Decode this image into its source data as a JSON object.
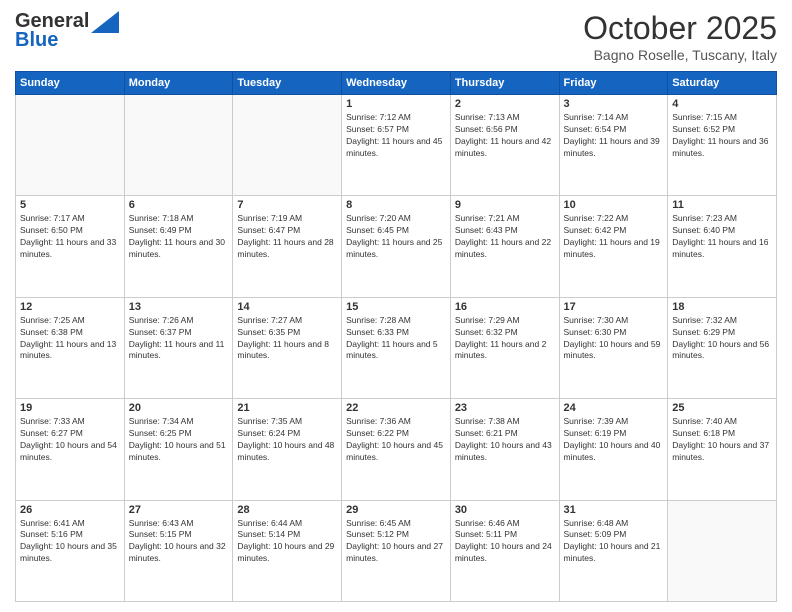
{
  "header": {
    "logo_line1": "General",
    "logo_line2": "Blue",
    "month": "October 2025",
    "location": "Bagno Roselle, Tuscany, Italy"
  },
  "days_of_week": [
    "Sunday",
    "Monday",
    "Tuesday",
    "Wednesday",
    "Thursday",
    "Friday",
    "Saturday"
  ],
  "weeks": [
    [
      {
        "day": "",
        "text": ""
      },
      {
        "day": "",
        "text": ""
      },
      {
        "day": "",
        "text": ""
      },
      {
        "day": "1",
        "text": "Sunrise: 7:12 AM\nSunset: 6:57 PM\nDaylight: 11 hours and 45 minutes."
      },
      {
        "day": "2",
        "text": "Sunrise: 7:13 AM\nSunset: 6:56 PM\nDaylight: 11 hours and 42 minutes."
      },
      {
        "day": "3",
        "text": "Sunrise: 7:14 AM\nSunset: 6:54 PM\nDaylight: 11 hours and 39 minutes."
      },
      {
        "day": "4",
        "text": "Sunrise: 7:15 AM\nSunset: 6:52 PM\nDaylight: 11 hours and 36 minutes."
      }
    ],
    [
      {
        "day": "5",
        "text": "Sunrise: 7:17 AM\nSunset: 6:50 PM\nDaylight: 11 hours and 33 minutes."
      },
      {
        "day": "6",
        "text": "Sunrise: 7:18 AM\nSunset: 6:49 PM\nDaylight: 11 hours and 30 minutes."
      },
      {
        "day": "7",
        "text": "Sunrise: 7:19 AM\nSunset: 6:47 PM\nDaylight: 11 hours and 28 minutes."
      },
      {
        "day": "8",
        "text": "Sunrise: 7:20 AM\nSunset: 6:45 PM\nDaylight: 11 hours and 25 minutes."
      },
      {
        "day": "9",
        "text": "Sunrise: 7:21 AM\nSunset: 6:43 PM\nDaylight: 11 hours and 22 minutes."
      },
      {
        "day": "10",
        "text": "Sunrise: 7:22 AM\nSunset: 6:42 PM\nDaylight: 11 hours and 19 minutes."
      },
      {
        "day": "11",
        "text": "Sunrise: 7:23 AM\nSunset: 6:40 PM\nDaylight: 11 hours and 16 minutes."
      }
    ],
    [
      {
        "day": "12",
        "text": "Sunrise: 7:25 AM\nSunset: 6:38 PM\nDaylight: 11 hours and 13 minutes."
      },
      {
        "day": "13",
        "text": "Sunrise: 7:26 AM\nSunset: 6:37 PM\nDaylight: 11 hours and 11 minutes."
      },
      {
        "day": "14",
        "text": "Sunrise: 7:27 AM\nSunset: 6:35 PM\nDaylight: 11 hours and 8 minutes."
      },
      {
        "day": "15",
        "text": "Sunrise: 7:28 AM\nSunset: 6:33 PM\nDaylight: 11 hours and 5 minutes."
      },
      {
        "day": "16",
        "text": "Sunrise: 7:29 AM\nSunset: 6:32 PM\nDaylight: 11 hours and 2 minutes."
      },
      {
        "day": "17",
        "text": "Sunrise: 7:30 AM\nSunset: 6:30 PM\nDaylight: 10 hours and 59 minutes."
      },
      {
        "day": "18",
        "text": "Sunrise: 7:32 AM\nSunset: 6:29 PM\nDaylight: 10 hours and 56 minutes."
      }
    ],
    [
      {
        "day": "19",
        "text": "Sunrise: 7:33 AM\nSunset: 6:27 PM\nDaylight: 10 hours and 54 minutes."
      },
      {
        "day": "20",
        "text": "Sunrise: 7:34 AM\nSunset: 6:25 PM\nDaylight: 10 hours and 51 minutes."
      },
      {
        "day": "21",
        "text": "Sunrise: 7:35 AM\nSunset: 6:24 PM\nDaylight: 10 hours and 48 minutes."
      },
      {
        "day": "22",
        "text": "Sunrise: 7:36 AM\nSunset: 6:22 PM\nDaylight: 10 hours and 45 minutes."
      },
      {
        "day": "23",
        "text": "Sunrise: 7:38 AM\nSunset: 6:21 PM\nDaylight: 10 hours and 43 minutes."
      },
      {
        "day": "24",
        "text": "Sunrise: 7:39 AM\nSunset: 6:19 PM\nDaylight: 10 hours and 40 minutes."
      },
      {
        "day": "25",
        "text": "Sunrise: 7:40 AM\nSunset: 6:18 PM\nDaylight: 10 hours and 37 minutes."
      }
    ],
    [
      {
        "day": "26",
        "text": "Sunrise: 6:41 AM\nSunset: 5:16 PM\nDaylight: 10 hours and 35 minutes."
      },
      {
        "day": "27",
        "text": "Sunrise: 6:43 AM\nSunset: 5:15 PM\nDaylight: 10 hours and 32 minutes."
      },
      {
        "day": "28",
        "text": "Sunrise: 6:44 AM\nSunset: 5:14 PM\nDaylight: 10 hours and 29 minutes."
      },
      {
        "day": "29",
        "text": "Sunrise: 6:45 AM\nSunset: 5:12 PM\nDaylight: 10 hours and 27 minutes."
      },
      {
        "day": "30",
        "text": "Sunrise: 6:46 AM\nSunset: 5:11 PM\nDaylight: 10 hours and 24 minutes."
      },
      {
        "day": "31",
        "text": "Sunrise: 6:48 AM\nSunset: 5:09 PM\nDaylight: 10 hours and 21 minutes."
      },
      {
        "day": "",
        "text": ""
      }
    ]
  ]
}
